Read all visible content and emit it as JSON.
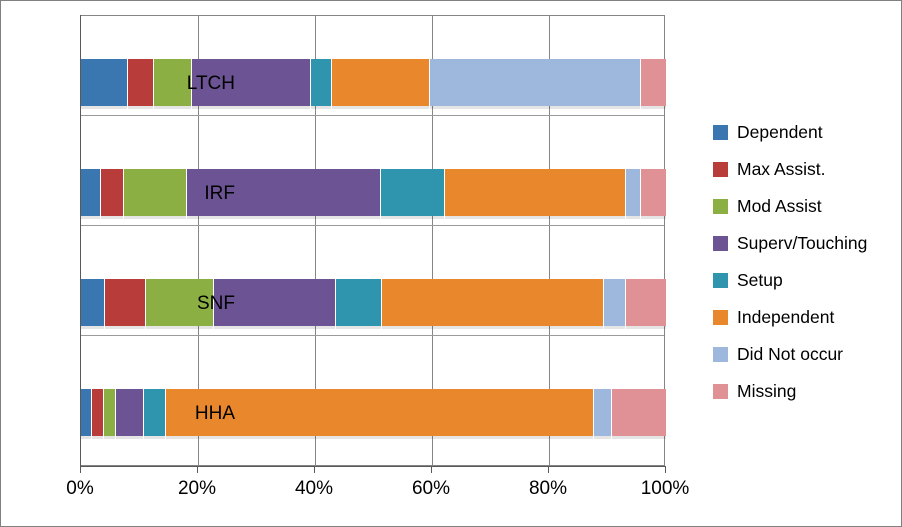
{
  "chart_data": {
    "type": "bar",
    "title": "",
    "subtitle": "",
    "xlabel": "",
    "ylabel": "",
    "orientation": "horizontal",
    "stacked": true,
    "stack_mode": "percent",
    "grid": true,
    "legend_position": "right",
    "xlim": [
      0,
      100
    ],
    "xticks": [
      0,
      20,
      40,
      60,
      80,
      100
    ],
    "xtick_labels": [
      "0%",
      "20%",
      "40%",
      "60%",
      "80%",
      "100%"
    ],
    "categories": [
      "LTCH",
      "IRF",
      "SNF",
      "HHA"
    ],
    "series": [
      {
        "name": "Dependent",
        "color": "#3A76AF",
        "values": [
          8.0,
          3.4,
          4.1,
          1.9
        ]
      },
      {
        "name": "Max Assist.",
        "color": "#B83C3A",
        "values": [
          4.4,
          3.9,
          7.0,
          2.0
        ]
      },
      {
        "name": "Mod Assist",
        "color": "#8BAF43",
        "values": [
          6.6,
          10.9,
          11.7,
          2.1
        ]
      },
      {
        "name": "Superv/Touching",
        "color": "#6B5394",
        "values": [
          20.3,
          33.1,
          20.8,
          4.8
        ]
      },
      {
        "name": "Setup",
        "color": "#2F95AE",
        "values": [
          3.6,
          10.9,
          7.9,
          3.7
        ]
      },
      {
        "name": "Independent",
        "color": "#E8872B",
        "values": [
          16.8,
          31.0,
          37.9,
          73.2
        ]
      },
      {
        "name": "Did Not occur",
        "color": "#9DB8DC",
        "values": [
          36.0,
          2.5,
          3.8,
          3.1
        ]
      },
      {
        "name": "Missing",
        "color": "#DF9195",
        "values": [
          4.3,
          4.3,
          6.8,
          9.2
        ]
      }
    ]
  },
  "legend": {
    "items": [
      {
        "label": "Dependent"
      },
      {
        "label": "Max Assist."
      },
      {
        "label": "Mod Assist"
      },
      {
        "label": "Superv/Touching"
      },
      {
        "label": "Setup"
      },
      {
        "label": "Independent"
      },
      {
        "label": "Did Not occur"
      },
      {
        "label": "Missing"
      }
    ]
  }
}
